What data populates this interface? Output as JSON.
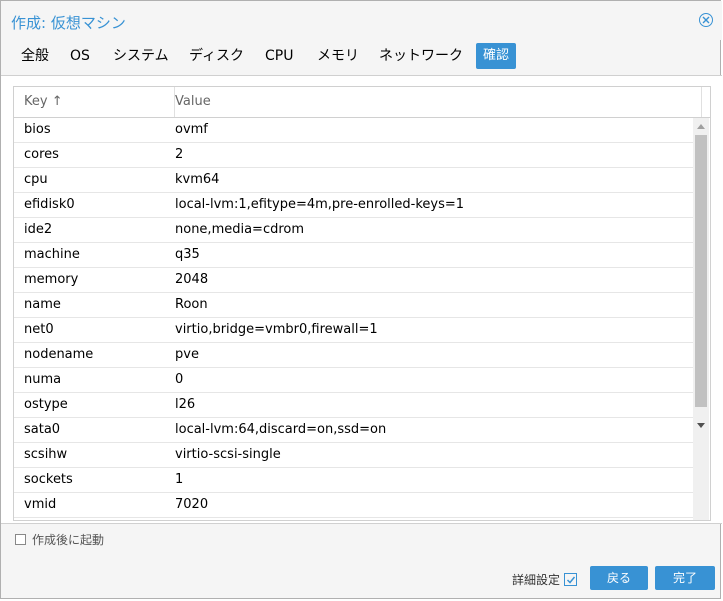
{
  "title": "作成: 仮想マシン",
  "tabs": [
    "全般",
    "OS",
    "システム",
    "ディスク",
    "CPU",
    "メモリ",
    "ネットワーク",
    "確認"
  ],
  "active_tab": "確認",
  "grid": {
    "key_header": "Key ↑",
    "value_header": "Value",
    "rows": [
      {
        "key": "bios",
        "value": "ovmf"
      },
      {
        "key": "cores",
        "value": "2"
      },
      {
        "key": "cpu",
        "value": "kvm64"
      },
      {
        "key": "efidisk0",
        "value": "local-lvm:1,efitype=4m,pre-enrolled-keys=1"
      },
      {
        "key": "ide2",
        "value": "none,media=cdrom"
      },
      {
        "key": "machine",
        "value": "q35"
      },
      {
        "key": "memory",
        "value": "2048"
      },
      {
        "key": "name",
        "value": "Roon"
      },
      {
        "key": "net0",
        "value": "virtio,bridge=vmbr0,firewall=1"
      },
      {
        "key": "nodename",
        "value": "pve"
      },
      {
        "key": "numa",
        "value": "0"
      },
      {
        "key": "ostype",
        "value": "l26"
      },
      {
        "key": "sata0",
        "value": "local-lvm:64,discard=on,ssd=on"
      },
      {
        "key": "scsihw",
        "value": "virtio-scsi-single"
      },
      {
        "key": "sockets",
        "value": "1"
      },
      {
        "key": "vmid",
        "value": "7020"
      }
    ]
  },
  "start_after_create": {
    "label": "作成後に起動",
    "checked": false
  },
  "footer": {
    "advanced_label": "詳細設定",
    "advanced_checked": true,
    "back_label": "戻る",
    "finish_label": "完了"
  },
  "colors": {
    "accent": "#3892d4"
  }
}
